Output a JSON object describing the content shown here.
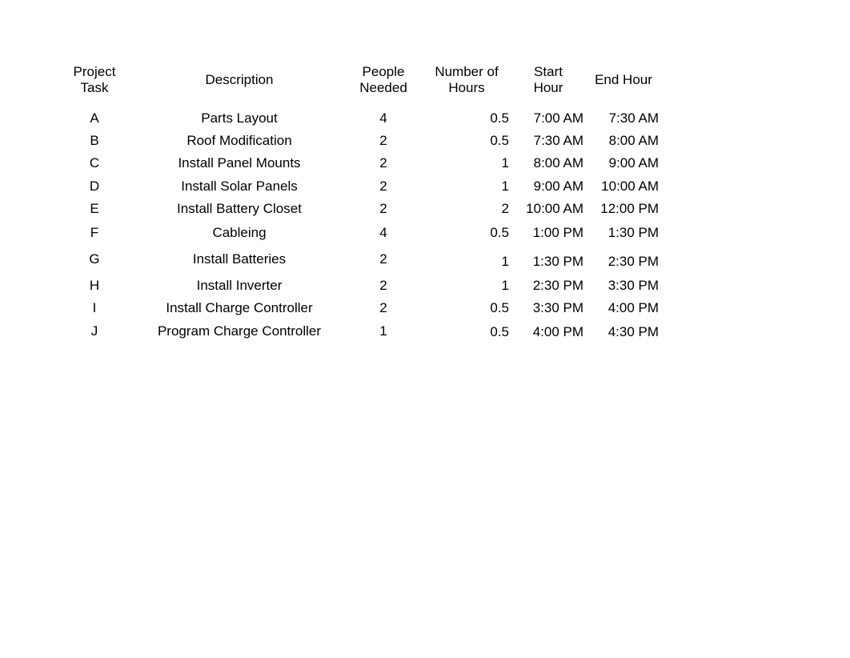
{
  "table": {
    "headers": {
      "task": [
        "Project",
        "Task"
      ],
      "description": "Description",
      "people": [
        "People",
        "Needed"
      ],
      "hours": [
        "Number of",
        "Hours"
      ],
      "start": [
        "Start",
        "Hour"
      ],
      "end": "End Hour"
    },
    "rows": [
      {
        "task": "A",
        "description": "Parts Layout",
        "people": "4",
        "hours": "0.5",
        "start": "7:00 AM",
        "end": "7:30 AM"
      },
      {
        "task": "B",
        "description": "Roof Modification",
        "people": "2",
        "hours": "0.5",
        "start": "7:30 AM",
        "end": "8:00 AM"
      },
      {
        "task": "C",
        "description": "Install Panel Mounts",
        "people": "2",
        "hours": "1",
        "start": "8:00 AM",
        "end": "9:00 AM"
      },
      {
        "task": "D",
        "description": "Install Solar Panels",
        "people": "2",
        "hours": "1",
        "start": "9:00 AM",
        "end": "10:00 AM"
      },
      {
        "task": "E",
        "description": "Install Battery Closet",
        "people": "2",
        "hours": "2",
        "start": "10:00 AM",
        "end": "12:00 PM"
      },
      {
        "task": "F",
        "description": "Cableing",
        "people": "4",
        "hours": "0.5",
        "start": "1:00 PM",
        "end": "1:30 PM"
      },
      {
        "task": "G",
        "description": "Install Batteries",
        "people": "2",
        "hours": "1",
        "start": "1:30 PM",
        "end": "2:30 PM"
      },
      {
        "task": "H",
        "description": "Install Inverter",
        "people": "2",
        "hours": "1",
        "start": "2:30 PM",
        "end": "3:30 PM"
      },
      {
        "task": "I",
        "description": "Install Charge Controller",
        "people": "2",
        "hours": "0.5",
        "start": "3:30 PM",
        "end": "4:00 PM"
      },
      {
        "task": "J",
        "description": "Program Charge Controller",
        "people": "1",
        "hours": "0.5",
        "start": "4:00 PM",
        "end": "4:30 PM"
      }
    ]
  }
}
